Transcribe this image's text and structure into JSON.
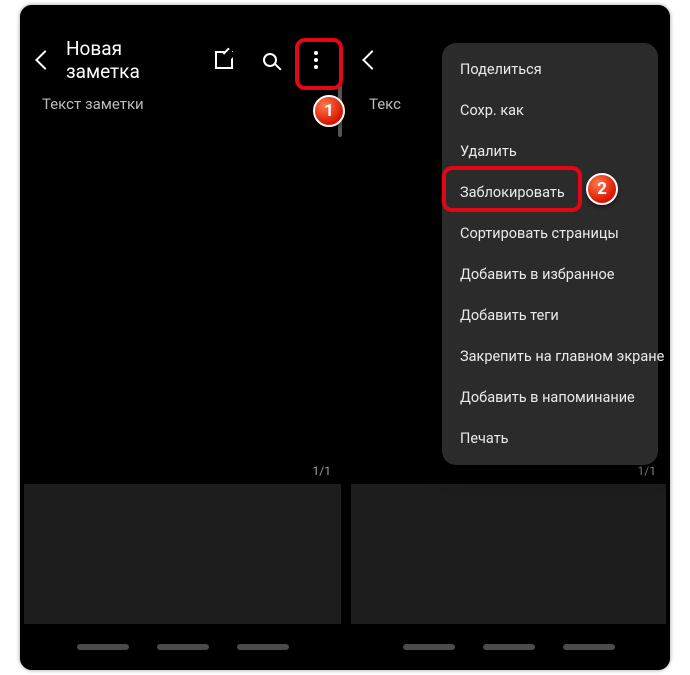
{
  "left": {
    "title": "Новая заметка",
    "body_placeholder": "Текст заметки",
    "pager": "1/1"
  },
  "right": {
    "body_placeholder": "Текс",
    "pager": "1/1"
  },
  "menu": {
    "items": [
      "Поделиться",
      "Сохр. как",
      "Удалить",
      "Заблокировать",
      "Сортировать страницы",
      "Добавить в избранное",
      "Добавить теги",
      "Закрепить на главном экране",
      "Добавить в напоминание",
      "Печать"
    ]
  },
  "annotations": {
    "badge1": "1",
    "badge2": "2"
  }
}
